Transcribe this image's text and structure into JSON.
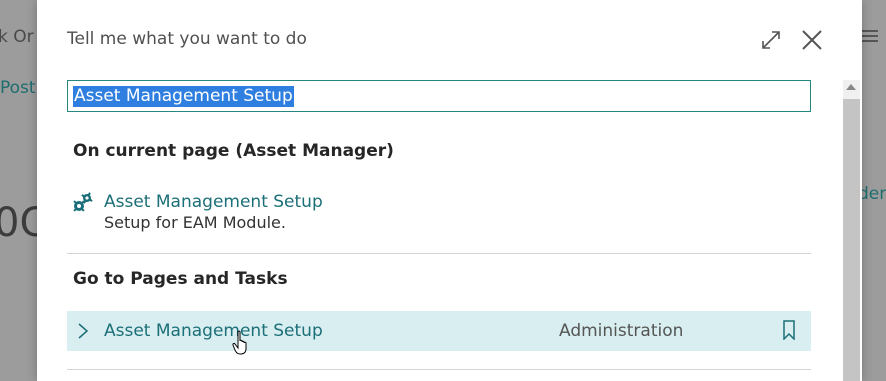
{
  "background": {
    "left_text_1": "k Or",
    "left_text_2": "Post",
    "left_text_3": "0C",
    "right_text_1": "der"
  },
  "dialog": {
    "title": "Tell me what you want to do",
    "search": {
      "value": "Asset Management Setup"
    },
    "section_current": {
      "title": "On current page (Asset Manager)",
      "item": {
        "label": "Asset Management Setup",
        "description": "Setup for EAM Module."
      }
    },
    "section_pages": {
      "title": "Go to Pages and Tasks",
      "item": {
        "label": "Asset Management Setup",
        "category": "Administration"
      }
    }
  },
  "colors": {
    "accent": "#26877f",
    "link": "#1b6f78",
    "selected_row": "#d8eef0",
    "selection": "#2f7fe0"
  }
}
